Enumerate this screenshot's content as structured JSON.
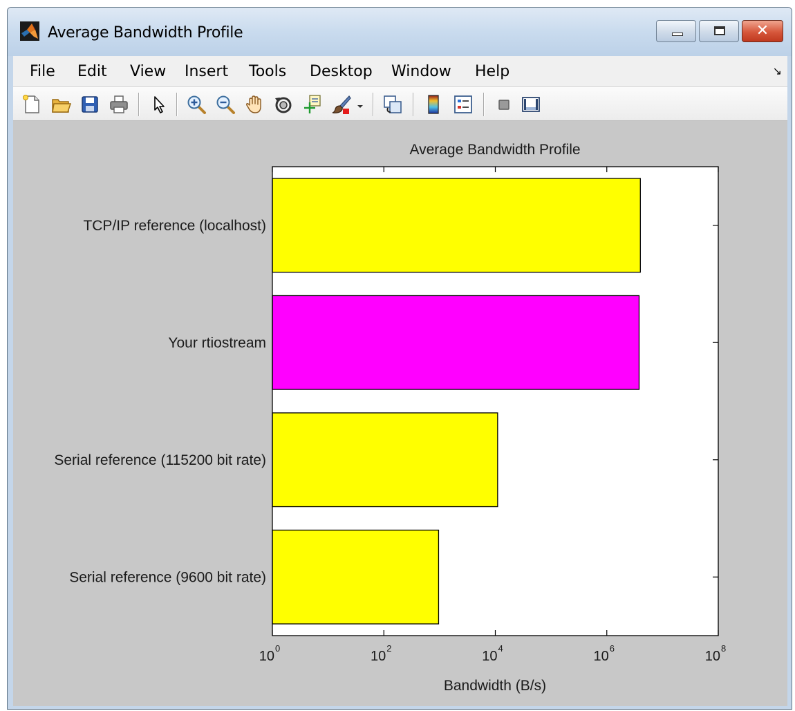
{
  "window": {
    "title": "Average Bandwidth Profile",
    "app_icon": "matlab-logo-icon",
    "controls": [
      "minimize-icon",
      "maximize-icon",
      "close-icon"
    ],
    "close_label": "✕"
  },
  "menubar": {
    "items": [
      "File",
      "Edit",
      "View",
      "Insert",
      "Tools",
      "Desktop",
      "Window",
      "Help"
    ],
    "overflow_icon": "menubar-dock-arrow-icon",
    "overflow_glyph": "↘"
  },
  "toolbar": {
    "tools": [
      {
        "icon": "new-figure-icon"
      },
      {
        "icon": "open-file-icon"
      },
      {
        "icon": "save-figure-icon"
      },
      {
        "icon": "print-figure-icon"
      },
      {
        "icon": "edit-plot-arrow-icon"
      },
      {
        "icon": "zoom-in-icon"
      },
      {
        "icon": "zoom-out-icon"
      },
      {
        "icon": "pan-hand-icon"
      },
      {
        "icon": "rotate-3d-icon"
      },
      {
        "icon": "data-cursor-icon"
      },
      {
        "icon": "brush-icon"
      },
      {
        "icon": "brush-dropdown-icon"
      },
      {
        "icon": "link-plot-icon"
      },
      {
        "icon": "insert-colorbar-icon"
      },
      {
        "icon": "insert-legend-icon"
      },
      {
        "icon": "hide-plot-tools-icon"
      },
      {
        "icon": "show-plot-tools-icon"
      }
    ]
  },
  "colors": {
    "bar_yellow": "#ffff00",
    "bar_magenta": "#ff00ff",
    "figure_bg": "#c8c8c8",
    "axes_bg": "#ffffff"
  },
  "chart_data": {
    "type": "bar",
    "orientation": "horizontal",
    "title": "Average Bandwidth Profile",
    "xlabel": "Bandwidth (B/s)",
    "ylabel": "",
    "xscale": "log",
    "xlim": [
      1,
      100000000
    ],
    "xticks": [
      {
        "base": "10",
        "exp": "0"
      },
      {
        "base": "10",
        "exp": "2"
      },
      {
        "base": "10",
        "exp": "4"
      },
      {
        "base": "10",
        "exp": "6"
      },
      {
        "base": "10",
        "exp": "8"
      }
    ],
    "grid": false,
    "categories": [
      "TCP/IP reference (localhost)",
      "Your rtiostream",
      "Serial reference (115200 bit rate)",
      "Serial reference (9600 bit rate)"
    ],
    "values": [
      4000000,
      3800000,
      11000,
      960
    ],
    "bar_colors": [
      "#ffff00",
      "#ff00ff",
      "#ffff00",
      "#ffff00"
    ]
  }
}
